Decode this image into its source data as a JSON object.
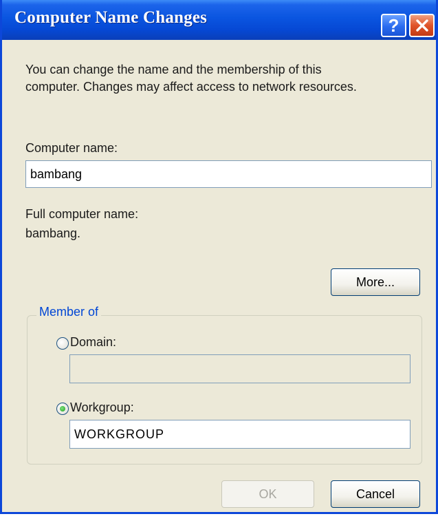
{
  "window": {
    "title": "Computer Name Changes",
    "help_icon": "question-mark",
    "close_icon": "x"
  },
  "description": {
    "line1": "You can change the name and the membership of this",
    "line2": "computer. Changes may affect access to network resources."
  },
  "computer_name": {
    "label": "Computer name:",
    "value": "bambang"
  },
  "full_computer_name": {
    "label": "Full computer name:",
    "value": "bambang."
  },
  "more_button": {
    "label": "More..."
  },
  "member_of": {
    "legend": "Member of",
    "domain": {
      "label": "Domain:",
      "value": "",
      "selected": false
    },
    "workgroup": {
      "label": "Workgroup:",
      "value": "WORKGROUP",
      "selected": true
    }
  },
  "footer": {
    "ok_label": "OK",
    "ok_enabled": false,
    "cancel_label": "Cancel"
  },
  "colors": {
    "titlebar": "#0a55e0",
    "dialog_bg": "#ece9d8",
    "groupbox_legend": "#0046d5",
    "close_button": "#e0542a"
  }
}
